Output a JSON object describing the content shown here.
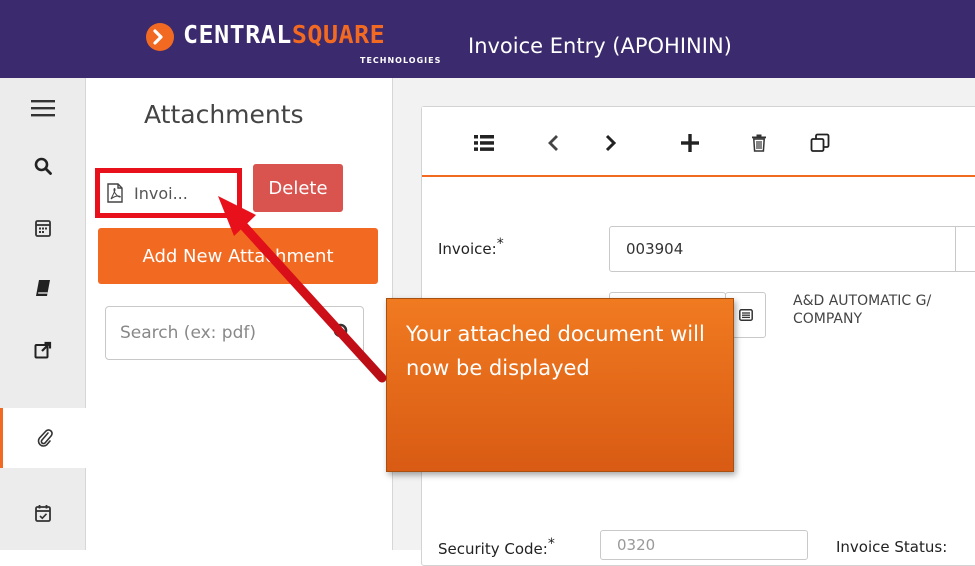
{
  "header": {
    "brand_main": "CENTRAL",
    "brand_accent": "SQUARE",
    "brand_sub": "TECHNOLOGIES",
    "title": "Invoice Entry (APOHININ)"
  },
  "rail": {
    "items": [
      {
        "icon": "hamburger-menu-icon"
      },
      {
        "icon": "search-icon"
      },
      {
        "icon": "calendar-icon"
      },
      {
        "icon": "book-icon"
      },
      {
        "icon": "external-link-icon"
      },
      {
        "icon": "paperclip-icon",
        "active": true
      },
      {
        "icon": "calendar-check-icon"
      }
    ]
  },
  "attachments": {
    "title": "Attachments",
    "file_label": "Invoi...",
    "file_icon": "pdf-file-icon",
    "delete_label": "Delete",
    "add_label": "Add New Attachment",
    "search_placeholder": "Search (ex: pdf)"
  },
  "toolbar": {
    "buttons": [
      "list-icon",
      "previous-icon",
      "next-icon",
      "add-icon",
      "delete-icon",
      "copy-icon"
    ]
  },
  "form": {
    "invoice_label": "Invoice:",
    "invoice_value": "003904",
    "vendor_value": "",
    "vendor_name_line1": "A&D AUTOMATIC G/",
    "vendor_name_line2": "COMPANY",
    "security_code_label": "Security Code:",
    "security_code_value": "0320",
    "invoice_status_label": "Invoice Status:"
  },
  "callout": {
    "text": "Your attached document will now be displayed"
  },
  "colors": {
    "header_bg": "#3b2a6e",
    "accent": "#f26a21",
    "delete_red": "#d9534f",
    "highlight_red": "#e8101a"
  }
}
